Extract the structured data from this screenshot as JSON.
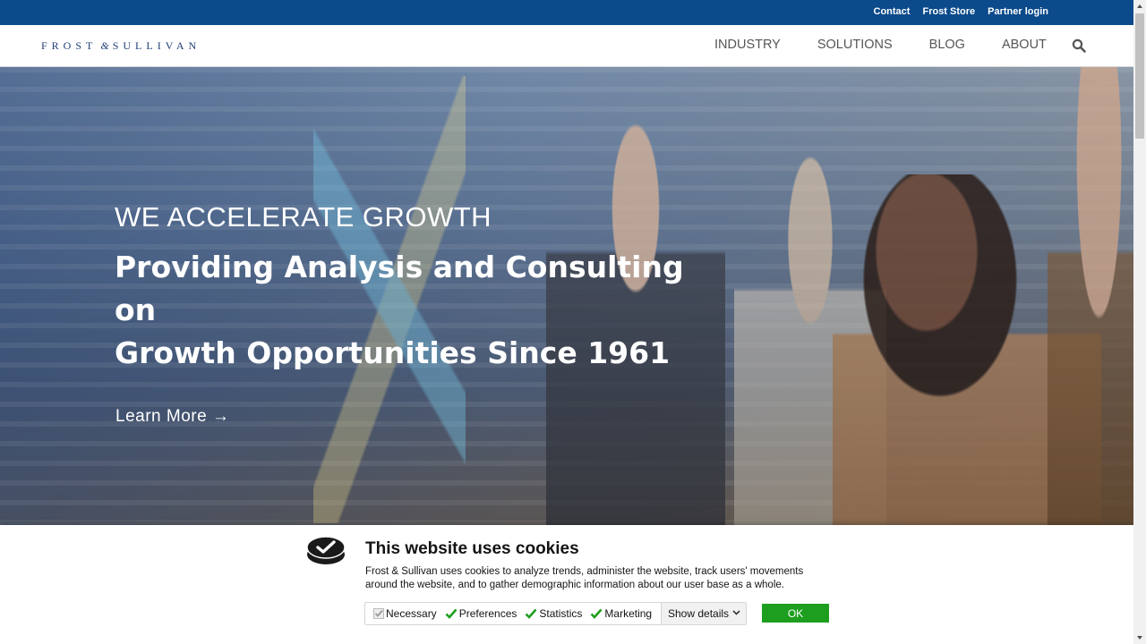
{
  "topbar": {
    "links": [
      "Contact",
      "Frost Store",
      "Partner login"
    ]
  },
  "header": {
    "logo_left": "FROST",
    "logo_amp": "&",
    "logo_right": "SULLIVAN",
    "nav": [
      "INDUSTRY",
      "SOLUTIONS",
      "BLOG",
      "ABOUT"
    ],
    "search_icon": "search-icon"
  },
  "hero": {
    "eyebrow": "WE ACCELERATE GROWTH",
    "headline_line1": "Providing Analysis and Consulting on",
    "headline_line2": "Growth Opportunities Since 1961",
    "cta": "Learn More →"
  },
  "cookie": {
    "title": "This website uses cookies",
    "text": "Frost & Sullivan uses cookies to analyze trends, administer the website, track users' movements around the website, and to gather demographic information about our user base as a whole.",
    "options": [
      "Necessary",
      "Preferences",
      "Statistics",
      "Marketing"
    ],
    "show_details": "Show details",
    "ok": "OK"
  },
  "colors": {
    "topbar": "#0b4a8b",
    "logo": "#1f3d73",
    "ok_button": "#1e9e1e"
  }
}
